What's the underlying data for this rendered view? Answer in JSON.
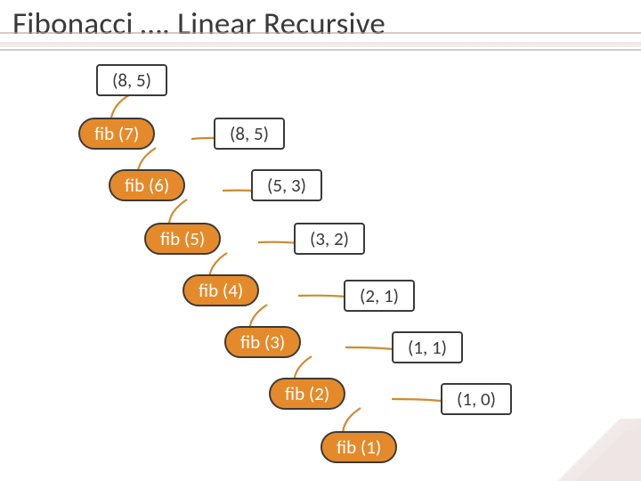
{
  "title": "Fibonacci …. Linear Recursive",
  "nodes": {
    "top85": "(8, 5)",
    "fib7": "fib (7)",
    "v85": "(8, 5)",
    "fib6": "fib (6)",
    "v53": "(5, 3)",
    "fib5": "fib (5)",
    "v32": "(3, 2)",
    "fib4": "fib (4)",
    "v21": "(2, 1)",
    "fib3": "fib (3)",
    "v11": "(1, 1)",
    "fib2": "fib (2)",
    "v10": "(1, 0)",
    "fib1": "fib (1)"
  }
}
